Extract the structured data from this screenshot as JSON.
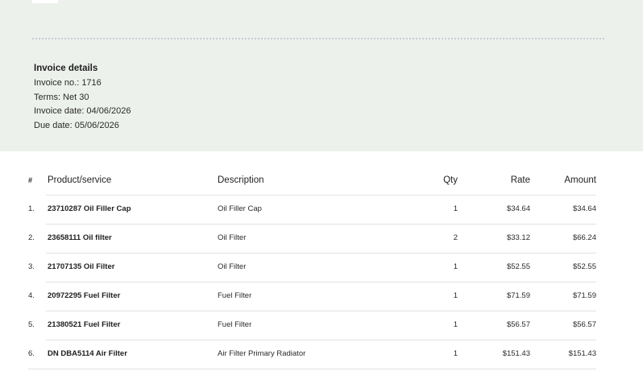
{
  "details": {
    "title": "Invoice details",
    "invoice_no": "Invoice no.: 1716",
    "terms": "Terms: Net 30",
    "invoice_date": "Invoice date: 04/06/2026",
    "due_date": "Due date: 05/06/2026"
  },
  "table": {
    "headers": {
      "num": "#",
      "product": "Product/service",
      "description": "Description",
      "qty": "Qty",
      "rate": "Rate",
      "amount": "Amount"
    },
    "rows": [
      {
        "num": "1.",
        "product": "23710287 Oil Filler Cap",
        "description": "Oil Filler Cap",
        "qty": "1",
        "rate": "$34.64",
        "amount": "$34.64"
      },
      {
        "num": "2.",
        "product": "23658111 Oil filter",
        "description": "Oil Filter",
        "qty": "2",
        "rate": "$33.12",
        "amount": "$66.24"
      },
      {
        "num": "3.",
        "product": "21707135 Oil Filter",
        "description": "Oil Filter",
        "qty": "1",
        "rate": "$52.55",
        "amount": "$52.55"
      },
      {
        "num": "4.",
        "product": "20972295 Fuel Filter",
        "description": "Fuel Filter",
        "qty": "1",
        "rate": "$71.59",
        "amount": "$71.59"
      },
      {
        "num": "5.",
        "product": "21380521 Fuel Filter",
        "description": "Fuel Filter",
        "qty": "1",
        "rate": "$56.57",
        "amount": "$56.57"
      },
      {
        "num": "6.",
        "product": "DN DBA5114 Air Filter",
        "description": "Air Filter Primary Radiator",
        "qty": "1",
        "rate": "$151.43",
        "amount": "$151.43"
      }
    ]
  }
}
